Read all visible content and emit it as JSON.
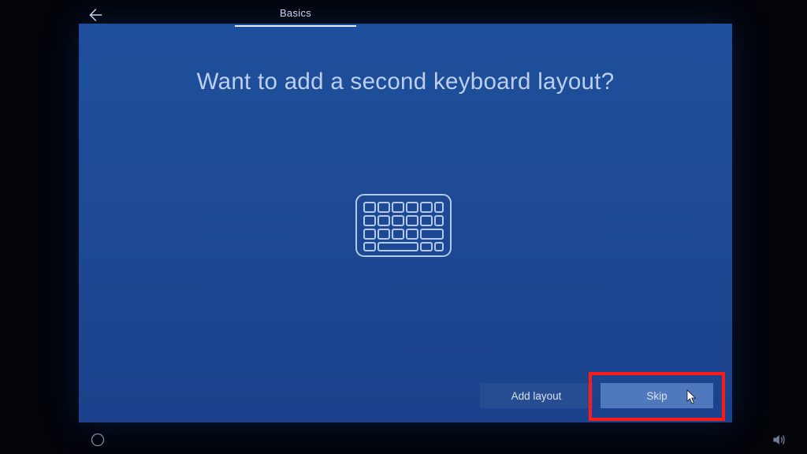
{
  "nav": {
    "tab_label": "Basics"
  },
  "heading": "Want to add a second keyboard layout?",
  "buttons": {
    "add_layout": "Add layout",
    "skip": "Skip"
  },
  "icons": {
    "back": "back-arrow-icon",
    "center": "keyboard-icon",
    "ease": "ease-of-access-icon",
    "sound": "sound-icon"
  },
  "annotation": {
    "highlighted": "skip-button",
    "color": "#ff1a1a"
  }
}
